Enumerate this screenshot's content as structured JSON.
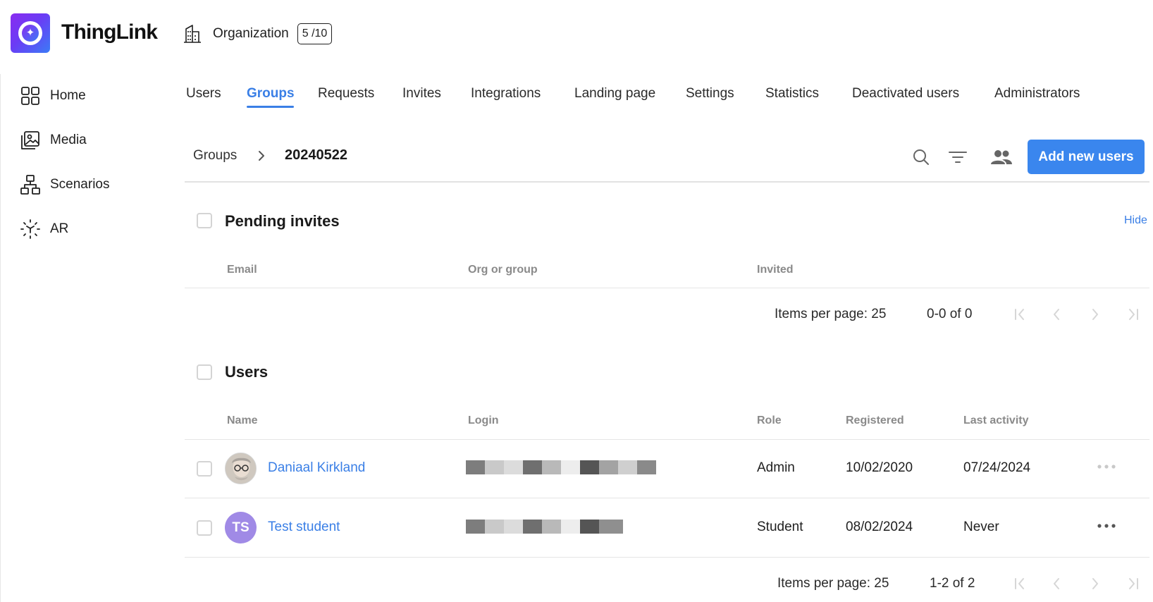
{
  "app": {
    "brand": "ThingLink",
    "logo_glyph": "✦",
    "org_label": "Organization",
    "org_seats": "5 /10"
  },
  "sidebar": {
    "items": [
      {
        "label": "Home",
        "icon": "home-grid-icon"
      },
      {
        "label": "Media",
        "icon": "media-gallery-icon"
      },
      {
        "label": "Scenarios",
        "icon": "scenarios-tree-icon"
      },
      {
        "label": "AR",
        "icon": "ar-cube-icon"
      }
    ]
  },
  "tabs": [
    {
      "label": "Users",
      "active": false
    },
    {
      "label": "Groups",
      "active": true
    },
    {
      "label": "Requests",
      "active": false
    },
    {
      "label": "Invites",
      "active": false
    },
    {
      "label": "Integrations",
      "active": false
    },
    {
      "label": "Landing page",
      "active": false
    },
    {
      "label": "Settings",
      "active": false
    },
    {
      "label": "Statistics",
      "active": false
    },
    {
      "label": "Deactivated users",
      "active": false
    },
    {
      "label": "Administrators",
      "active": false
    }
  ],
  "breadcrumb": {
    "root": "Groups",
    "current": "20240522"
  },
  "toolbar": {
    "icons": [
      "search-icon",
      "filter-icon",
      "group-users-icon"
    ],
    "add_button_label": "Add new users"
  },
  "pending": {
    "title": "Pending invites",
    "hide_label": "Hide",
    "columns": [
      "Email",
      "Org or group",
      "Invited"
    ],
    "rows": [],
    "pager": {
      "items_per_page": "Items per page: 25",
      "range": "0-0 of 0"
    }
  },
  "users": {
    "title": "Users",
    "columns": [
      "Name",
      "Login",
      "Role",
      "Registered",
      "Last activity"
    ],
    "rows": [
      {
        "name": "Daniaal Kirkland",
        "avatar": "photo",
        "initials": "",
        "role": "Admin",
        "registered": "10/02/2020",
        "last_activity": "07/24/2024"
      },
      {
        "name": "Test student",
        "avatar": "initials",
        "initials": "TS",
        "role": "Student",
        "registered": "08/02/2024",
        "last_activity": "Never"
      }
    ],
    "pager": {
      "items_per_page": "Items per page: 25",
      "range": "1-2 of 2"
    }
  },
  "colors": {
    "accent": "#3a7fe6",
    "button": "#3a86ee",
    "avatar_ts": "#a08ae6"
  }
}
